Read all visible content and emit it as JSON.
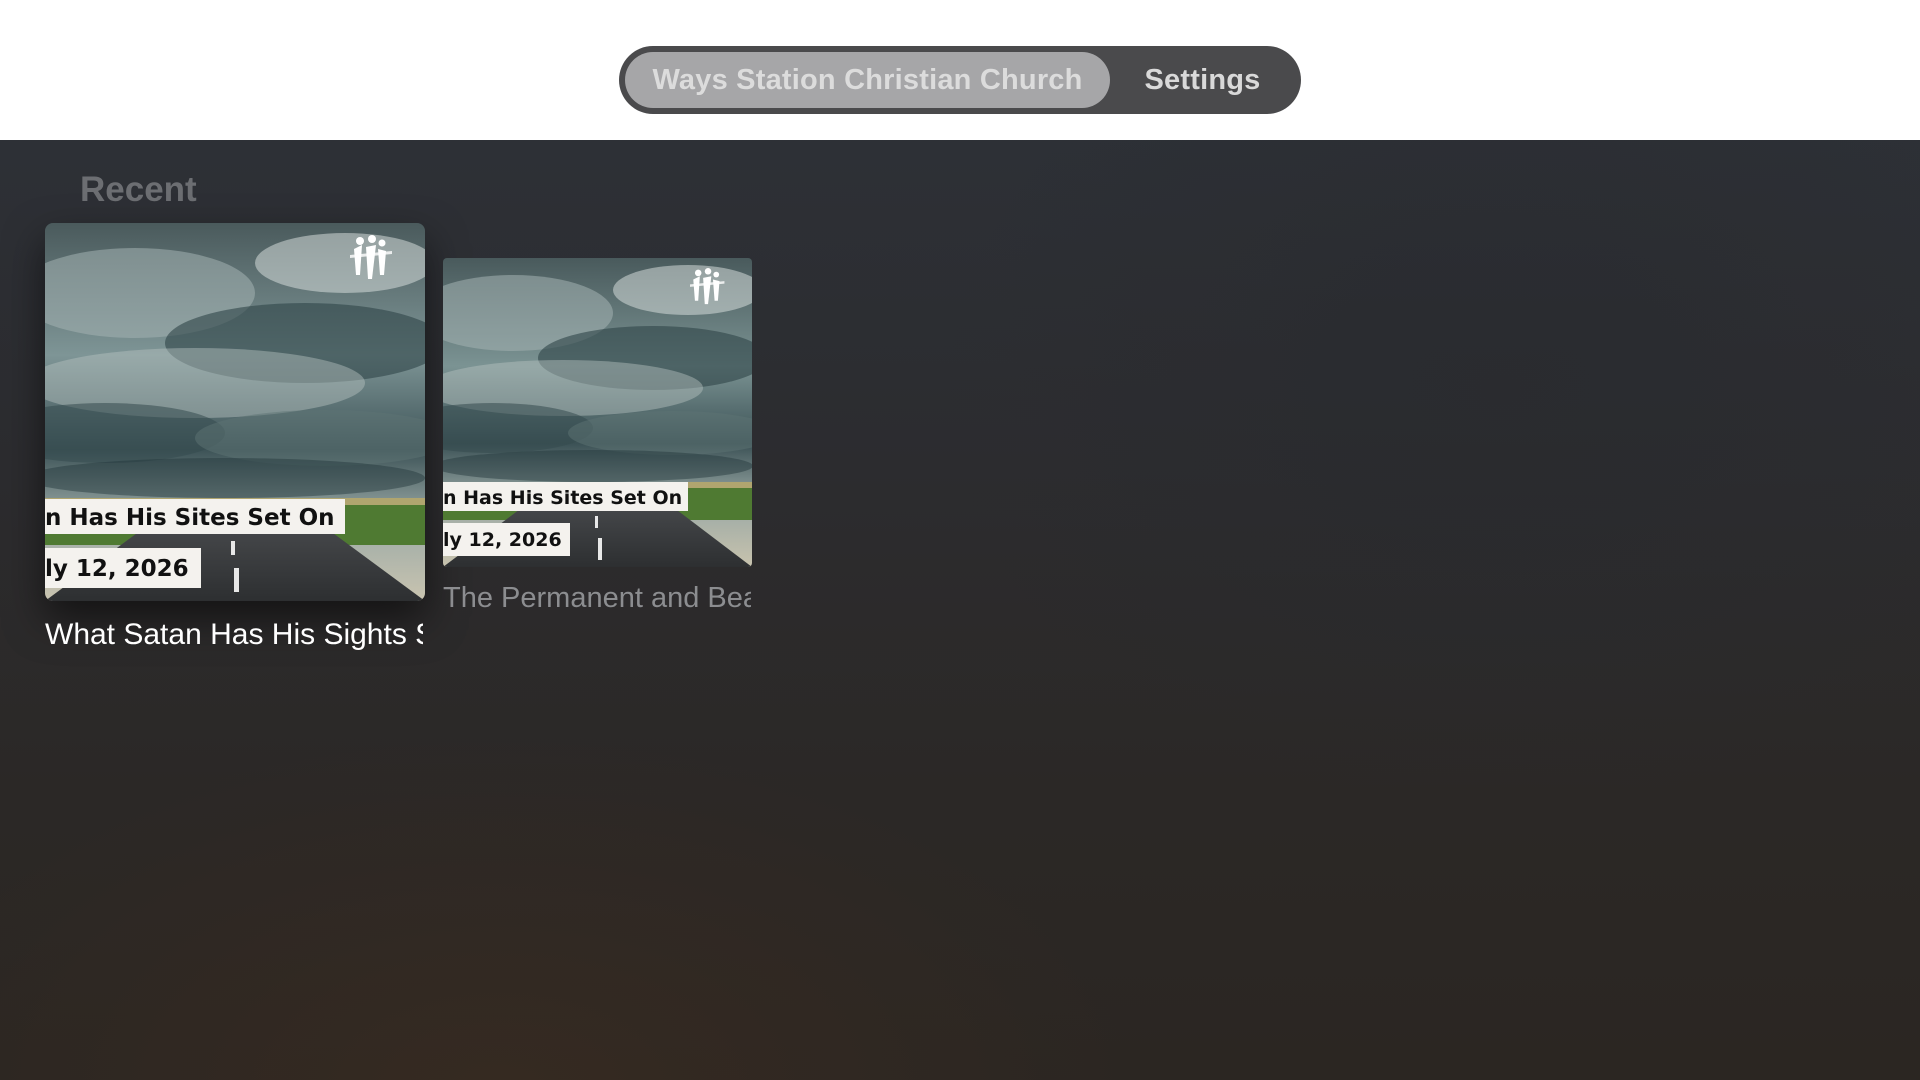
{
  "tabs": [
    {
      "label": "Ways Station Christian Church",
      "selected": true
    },
    {
      "label": "Settings",
      "selected": false
    }
  ],
  "section": {
    "title": "Recent"
  },
  "items": [
    {
      "thumbnail": {
        "line1": "n Has His Sites Set On",
        "line2": "ly 12, 2026",
        "logo": "church-logo-icon"
      },
      "title": "What Satan Has His Sights Set On",
      "focused": true
    },
    {
      "thumbnail": {
        "line1": "n Has His Sites Set On",
        "line2": "ly 12, 2026",
        "logo": "church-logo-icon"
      },
      "title": "The Permanent and Beautiful",
      "focused": false
    }
  ]
}
